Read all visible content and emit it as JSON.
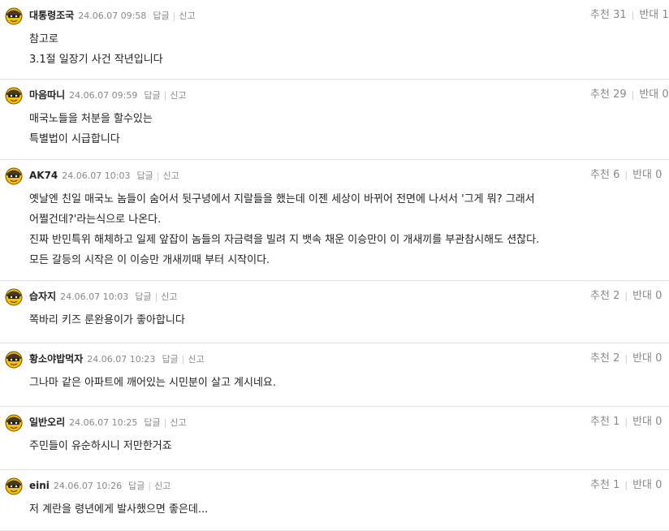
{
  "ui": {
    "reply_label": "답글",
    "report_label": "신고",
    "up_label": "추천",
    "down_label": "반대"
  },
  "comments": [
    {
      "nick": "대통령조국",
      "date": "24.06.07 09:58",
      "up": "31",
      "down": "1",
      "lines": [
        "참고로",
        "3.1절 일장기 사건 작년입니다"
      ]
    },
    {
      "nick": "마음따니",
      "date": "24.06.07 09:59",
      "up": "29",
      "down": "0",
      "lines": [
        "매국노들을 처분을 할수있는",
        "특별법이 시급합니다"
      ]
    },
    {
      "nick": "AK74",
      "date": "24.06.07 10:03",
      "up": "6",
      "down": "0",
      "lines": [
        "옛날엔 친일 매국노 놈들이 숨어서 뒷구녕에서 지랄들을 했는데 이젠 세상이 바뀌어 전면에 나서서 '그게 뭐? 그래서",
        "어쩔건데?'라는식으로 나온다.",
        "진짜 반민특위 해체하고 일제 앞잡이 놈들의 자금력을 빌려 지 뱃속 채운 이승만이 이 개새끼를 부관참시해도 션찮다.",
        "모든 갈등의 시작은 이 이승만 개새끼때 부터 시작이다."
      ]
    },
    {
      "nick": "습자지",
      "date": "24.06.07 10:03",
      "up": "2",
      "down": "0",
      "lines": [
        "쪽바리 키즈 룬완용이가 좋아합니다"
      ]
    },
    {
      "nick": "황소야밥먹자",
      "date": "24.06.07 10:23",
      "up": "2",
      "down": "0",
      "lines": [
        "그나마 같은 아파트에 깨어있는 시민분이 살고 계시네요."
      ]
    },
    {
      "nick": "일반오리",
      "date": "24.06.07 10:25",
      "up": "1",
      "down": "0",
      "lines": [
        "주민들이 유순하시니 저만한거죠"
      ]
    },
    {
      "nick": "eini",
      "date": "24.06.07 10:26",
      "up": "1",
      "down": "0",
      "lines": [
        "저 계란을 령년에게 발사했으면 좋은데..."
      ]
    }
  ]
}
